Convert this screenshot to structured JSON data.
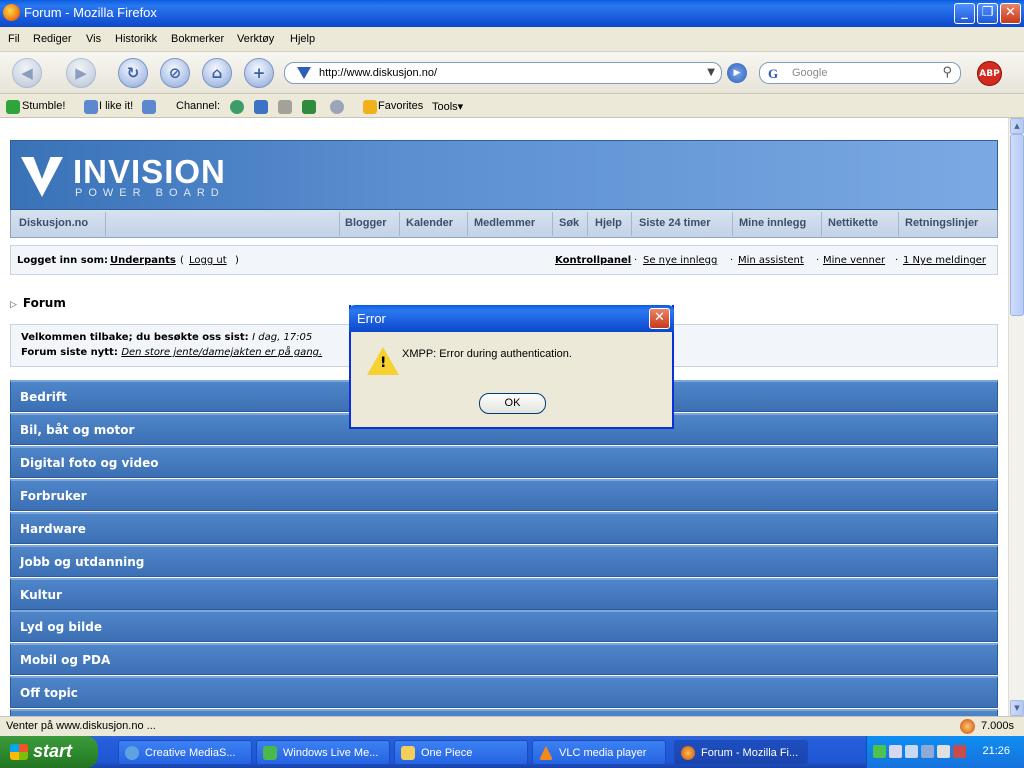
{
  "window": {
    "title": "Forum - Mozilla Firefox"
  },
  "menu": [
    "Fil",
    "Rediger",
    "Vis",
    "Historikk",
    "Bokmerker",
    "Verktøy",
    "Hjelp"
  ],
  "navbar": {
    "url": "http://www.diskusjon.no/",
    "search_placeholder": "Google",
    "search_engine_icon": "G",
    "abp_label": "ABP"
  },
  "stumblebar": {
    "stumble": "Stumble!",
    "like": "I like it!",
    "channel": "Channel:",
    "favorites": "Favorites",
    "tools": "Tools▾"
  },
  "forum": {
    "logo": "INVISION",
    "logo_sub": "POWER BOARD",
    "home": "Diskusjon.no",
    "nav": [
      "Blogger",
      "Kalender",
      "Medlemmer",
      "Søk",
      "Hjelp",
      "Siste 24 timer",
      "Mine innlegg",
      "Nettikette",
      "Retningslinjer"
    ],
    "user": {
      "prefix": "Logget inn som:",
      "name": "Underpants",
      "logout_open": "(",
      "logout": "Logg ut",
      "logout_close": ")"
    },
    "user_links": [
      "Kontrollpanel",
      "Se nye innlegg",
      "Min assistent",
      "Mine venner",
      "1 Nye meldinger"
    ],
    "breadcrumb": "Forum",
    "welcome": {
      "line1_label": "Velkommen tilbake; du besøkte oss sist:",
      "line1_value": "I dag, 17:05",
      "line2_label": "Forum siste nytt:",
      "line2_value": "Den store jente/damejakten er på gang."
    },
    "categories": [
      "Bedrift",
      "Bil, båt og motor",
      "Digital foto og video",
      "Forbruker",
      "Hardware",
      "Jobb og utdanning",
      "Kultur",
      "Lyd og bilde",
      "Mobil og PDA",
      "Off topic"
    ]
  },
  "dialog": {
    "title": "Error",
    "message": "XMPP: Error during authentication.",
    "ok": "OK"
  },
  "status": {
    "text": "Venter på www.diskusjon.no ...",
    "time": "7.000s"
  },
  "taskbar": {
    "start": "start",
    "tasks": [
      "Creative MediaS...",
      "Windows Live Me...",
      "One Piece",
      "VLC media player",
      "Forum - Mozilla Fi..."
    ],
    "clock": "21:26"
  }
}
